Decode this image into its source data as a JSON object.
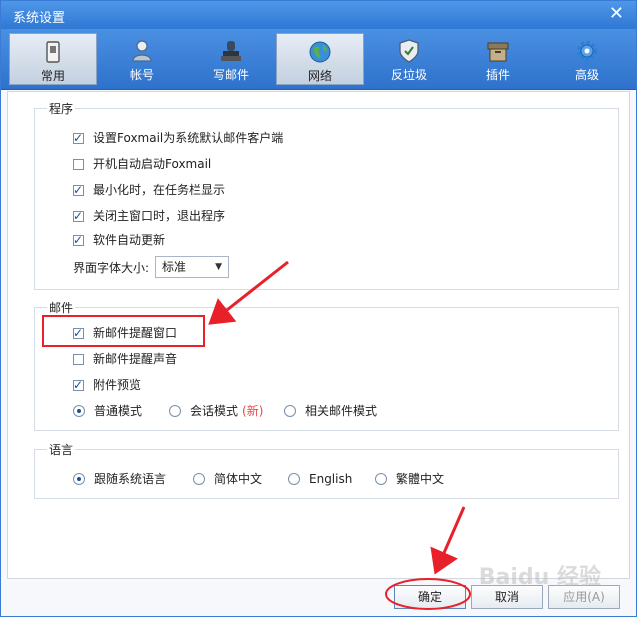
{
  "window": {
    "title": "系统设置"
  },
  "toolbar": {
    "items": [
      {
        "label": "常用",
        "icon": "phone-icon"
      },
      {
        "label": "帐号",
        "icon": "user-icon"
      },
      {
        "label": "写邮件",
        "icon": "stamp-icon"
      },
      {
        "label": "网络",
        "icon": "globe-icon"
      },
      {
        "label": "反垃圾",
        "icon": "shield-icon"
      },
      {
        "label": "插件",
        "icon": "box-icon"
      },
      {
        "label": "高级",
        "icon": "gear-icon"
      }
    ],
    "active_index": 0
  },
  "program": {
    "title": "程序",
    "options": [
      {
        "label": "设置Foxmail为系统默认邮件客户端",
        "checked": true
      },
      {
        "label": "开机自动启动Foxmail",
        "checked": false
      },
      {
        "label": "最小化时，在任务栏显示",
        "checked": true
      },
      {
        "label": "关闭主窗口时，退出程序",
        "checked": true
      },
      {
        "label": "软件自动更新",
        "checked": true
      }
    ],
    "font_size_label": "界面字体大小:",
    "font_size_value": "标准"
  },
  "mail": {
    "title": "邮件",
    "options": [
      {
        "label": "新邮件提醒窗口",
        "checked": true
      },
      {
        "label": "新邮件提醒声音",
        "checked": false
      },
      {
        "label": "附件预览",
        "checked": true
      }
    ],
    "modes": [
      {
        "label": "普通模式",
        "checked": true
      },
      {
        "label": "会话模式",
        "checked": false,
        "tag": "(新)"
      },
      {
        "label": "相关邮件模式",
        "checked": false
      }
    ]
  },
  "language": {
    "title": "语言",
    "options": [
      {
        "label": "跟随系统语言",
        "checked": true
      },
      {
        "label": "简体中文",
        "checked": false
      },
      {
        "label": "English",
        "checked": false
      },
      {
        "label": "繁體中文",
        "checked": false
      }
    ]
  },
  "buttons": {
    "ok": "确定",
    "cancel": "取消",
    "apply": "应用(A)"
  },
  "colors": {
    "accent": "#2f78d4",
    "annotation_red": "#e8202a",
    "check_blue": "#1a4fa0"
  }
}
